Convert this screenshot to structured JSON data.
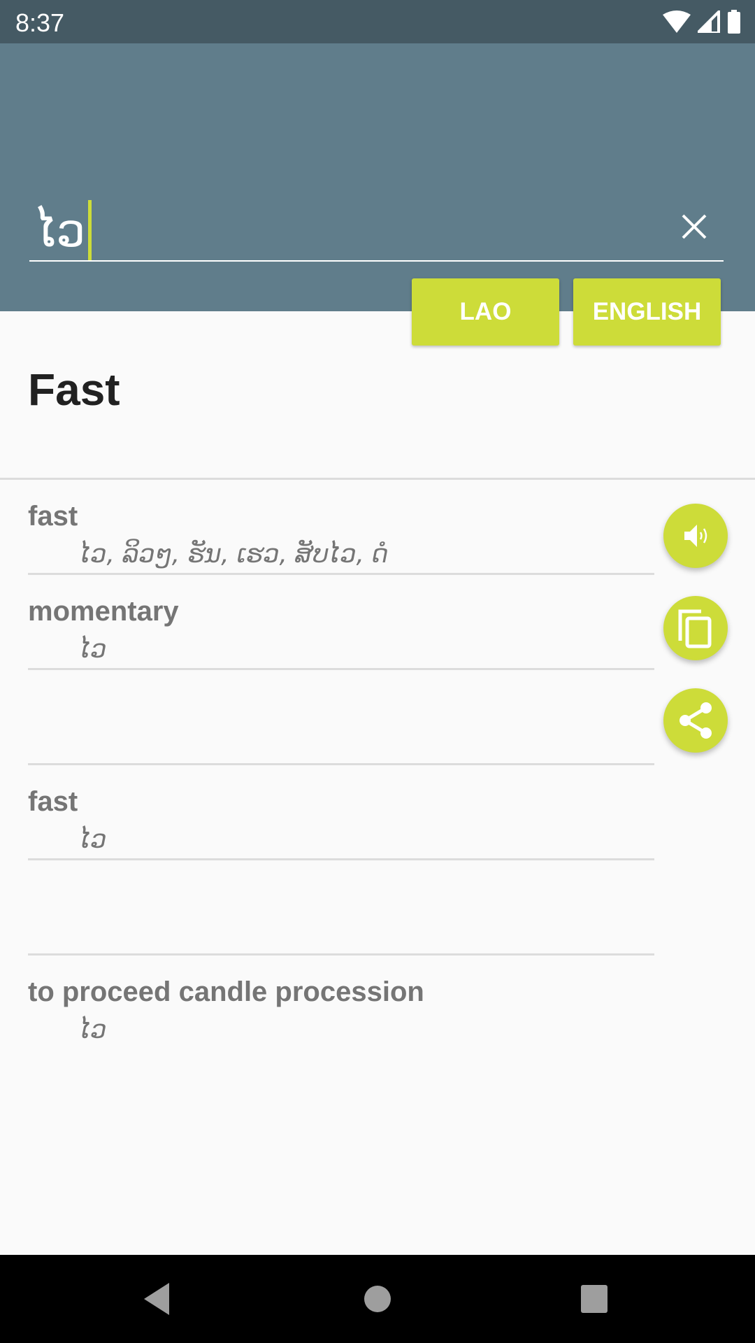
{
  "status_bar": {
    "time": "8:37",
    "icons": [
      "wifi-icon",
      "cellular-signal-icon",
      "battery-icon"
    ]
  },
  "search": {
    "value": "ໄວ",
    "clear_icon": "close-icon"
  },
  "language_buttons": {
    "source": "LAO",
    "target": "ENGLISH"
  },
  "result": {
    "title": "Fast"
  },
  "entries": [
    {
      "word": "fast",
      "translation": "ໄວ, ລິວໆ, ຮັນ, ເຮວ, ສັບໄວ, ດໍ"
    },
    {
      "word": "momentary",
      "translation": "ໄວ"
    },
    {
      "word": "",
      "translation": ""
    },
    {
      "word": "fast",
      "translation": "ໄວ"
    },
    {
      "word": "",
      "translation": ""
    },
    {
      "word": "to proceed candle procession",
      "translation": "ໄວ"
    }
  ],
  "actions": [
    {
      "name": "speaker-icon",
      "label": "Speak"
    },
    {
      "name": "copy-icon",
      "label": "Copy"
    },
    {
      "name": "share-icon",
      "label": "Share"
    }
  ],
  "colors": {
    "status_bar": "#455a64",
    "header": "#607d8b",
    "accent": "#cddc39",
    "title_text": "#212121",
    "entry_text": "#757575"
  },
  "nav_bar": [
    "back-icon",
    "home-icon",
    "recents-icon"
  ]
}
